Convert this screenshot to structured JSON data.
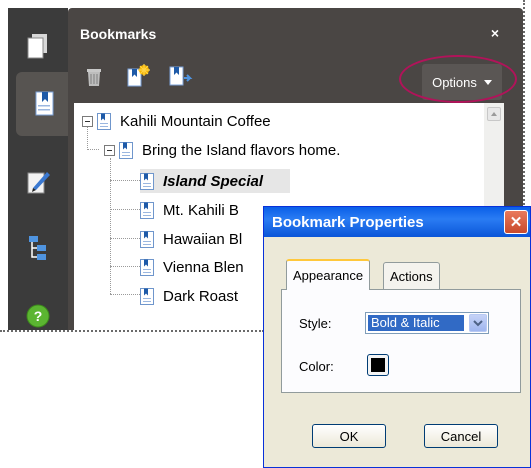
{
  "panel": {
    "title": "Bookmarks",
    "close_glyph": "×",
    "options_label": "Options"
  },
  "rail": {
    "icons": [
      "pages-icon",
      "bookmarks-icon",
      "signatures-icon",
      "model-tree-icon",
      "help-icon"
    ]
  },
  "toolbar": {
    "icons": [
      "trash-icon",
      "new-bookmark-icon",
      "new-bookmark-from-structure-icon"
    ]
  },
  "tree": {
    "items": [
      {
        "label": "Kahili Mountain Coffee",
        "level": 0
      },
      {
        "label": "Bring the Island flavors home.",
        "level": 1
      },
      {
        "label": "Island Special",
        "level": 2,
        "selected": true
      },
      {
        "label": "Mt. Kahili B",
        "level": 2
      },
      {
        "label": "Hawaiian Bl",
        "level": 2
      },
      {
        "label": "Vienna Blen",
        "level": 2
      },
      {
        "label": "Dark Roast",
        "level": 2
      }
    ]
  },
  "dialog": {
    "title": "Bookmark Properties",
    "close_glyph": "✕",
    "tabs": [
      "Appearance",
      "Actions"
    ],
    "style_label": "Style:",
    "style_value": "Bold & Italic",
    "color_label": "Color:",
    "color_value": "#000000",
    "ok_label": "OK",
    "cancel_label": "Cancel"
  },
  "colors": {
    "panel_bg": "#4a4644",
    "highlight_circle": "#b1135a",
    "dialog_titlebar": "#0a5fe8"
  }
}
